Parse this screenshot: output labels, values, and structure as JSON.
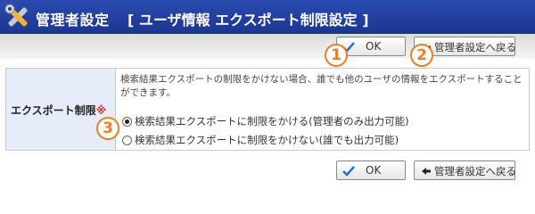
{
  "header": {
    "title": "管理者設定",
    "subtitle": "[ ユーザ情報 エクスポート制限設定 ]"
  },
  "buttons": {
    "ok_label": "OK",
    "back_label": "管理者設定へ戻る"
  },
  "callouts": {
    "one": "1",
    "two": "2",
    "three": "3"
  },
  "form": {
    "label": "エクスポート制限",
    "required_mark": "※",
    "description": "検索結果エクスポートの制限をかけない場合、誰でも他のユーザの情報をエクスポートすることができます。",
    "options": [
      {
        "label": "検索結果エクスポートに制限をかける(管理者のみ出力可能)",
        "selected": true
      },
      {
        "label": "検索結果エクスポートに制限をかけない(誰でも出力可能)",
        "selected": false
      }
    ]
  },
  "icons": {
    "header": "tools-icon",
    "ok": "checkmark-icon",
    "back": "back-arrow-icon"
  },
  "colors": {
    "header_bg": "#1f3b9e",
    "callout": "#f07d28",
    "label_bg": "#e6ecf9",
    "required": "#e0332a"
  }
}
